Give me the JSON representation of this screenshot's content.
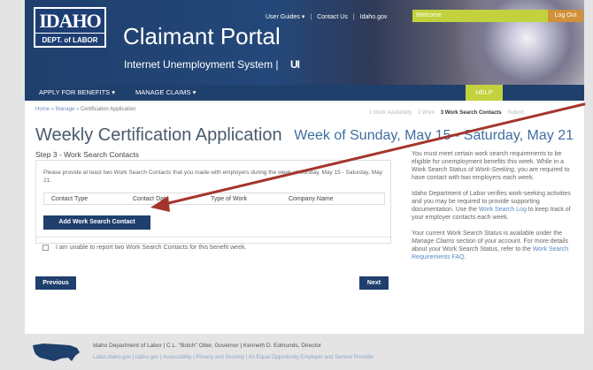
{
  "header": {
    "logo_top": "IDAHO",
    "logo_bottom": "DEPT. of LABOR",
    "title": "Claimant Portal",
    "subtitle": "Internet Unemployment System |",
    "subtitle_mark": "UI",
    "top_links": [
      "User Guides ▾",
      "Contact Us",
      "Idaho.gov"
    ],
    "welcome": "Welcome",
    "logout": "Log Out"
  },
  "nav": {
    "apply": "APPLY FOR BENEFITS ▾",
    "manage": "MANAGE CLAIMS ▾",
    "help": "HELP"
  },
  "breadcrumb": {
    "home": "Home",
    "manage": "Manage",
    "current": "Certification Application",
    "sep": "»"
  },
  "steps": [
    "1 Work Availability",
    "2 Work",
    "3 Work Search Contacts",
    "Submit"
  ],
  "main": {
    "title": "Weekly Certification Application",
    "week_range": "Week of Sunday, May 15 - Saturday, May 21",
    "step_heading": "Step 3 - Work Search Contacts",
    "instructions": "Please provide at least two Work Search Contacts that you made with employers during the week of Sunday, May 15 - Saturday, May 21.",
    "table_headers": [
      "Contact Type",
      "Contact Date",
      "Type of Work",
      "Company Name"
    ],
    "add_button": "Add Work Search Contact",
    "unable_label": "I am unable to report two Work Search Contacts for this benefit week.",
    "previous_button": "Previous",
    "next_button": "Next"
  },
  "sidebar": {
    "p1_a": "You must meet certain work search requirements to be eligible for unemployment benefits this week. While in a Work Search Status of ",
    "p1_italic": "Work-Seeking",
    "p1_b": ", you are required to have contact with two employers each week.",
    "p2_a": "Idaho Department of Labor verifies work-seeking activities and you may be required to provide supporting documentation. Use the ",
    "p2_link": "Work Search Log",
    "p2_b": " to keep track of your employer contacts each week.",
    "p3_a": "Your current Work Search Status is available under the ",
    "p3_italic": "Manage Claims",
    "p3_b": " section of your account. For more details about your Work Search Status, refer to the ",
    "p3_link": "Work Search Requirements FAQ",
    "p3_c": "."
  },
  "footer": {
    "line1": "Idaho Department of Labor | C.L. \"Butch\" Otter, Governor | Kenneth D. Edmunds, Director",
    "line2": "Labor.Idaho.gov | Idaho.gov | Accessibility | Privacy and Security | An Equal Opportunity Employer and Service Provider"
  },
  "colors": {
    "navy": "#1f3f6d",
    "green": "#c2d23c",
    "orange": "#d1913a",
    "arrow": "#a5352c"
  }
}
